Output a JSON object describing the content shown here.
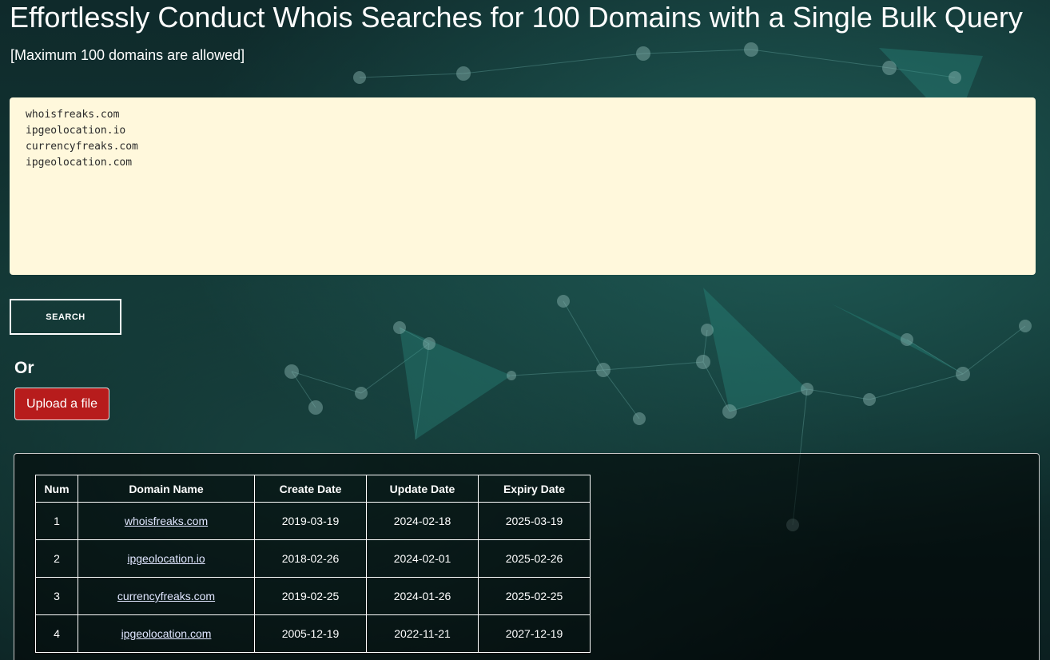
{
  "page": {
    "title": "Effortlessly Conduct Whois Searches for 100 Domains with a Single Bulk Query",
    "subtitle": "[Maximum 100 domains are allowed]"
  },
  "form": {
    "domains_text": "whoisfreaks.com\nipgeolocation.io\ncurrencyfreaks.com\nipgeolocation.com",
    "search_label": "SEARCH",
    "or_label": "Or",
    "upload_label": "Upload a file"
  },
  "table": {
    "headers": {
      "num": "Num",
      "domain": "Domain Name",
      "create": "Create Date",
      "update": "Update Date",
      "expiry": "Expiry Date"
    },
    "rows": [
      {
        "num": "1",
        "domain": "whoisfreaks.com",
        "create": "2019-03-19",
        "update": "2024-02-18",
        "expiry": "2025-03-19"
      },
      {
        "num": "2",
        "domain": "ipgeolocation.io",
        "create": "2018-02-26",
        "update": "2024-02-01",
        "expiry": "2025-02-26"
      },
      {
        "num": "3",
        "domain": "currencyfreaks.com",
        "create": "2019-02-25",
        "update": "2024-01-26",
        "expiry": "2025-02-25"
      },
      {
        "num": "4",
        "domain": "ipgeolocation.com",
        "create": "2005-12-19",
        "update": "2022-11-21",
        "expiry": "2027-12-19"
      }
    ]
  },
  "colors": {
    "textarea_bg": "#fff8dc",
    "upload_button": "#b71c1c",
    "background_teal": "#1f5a55"
  }
}
